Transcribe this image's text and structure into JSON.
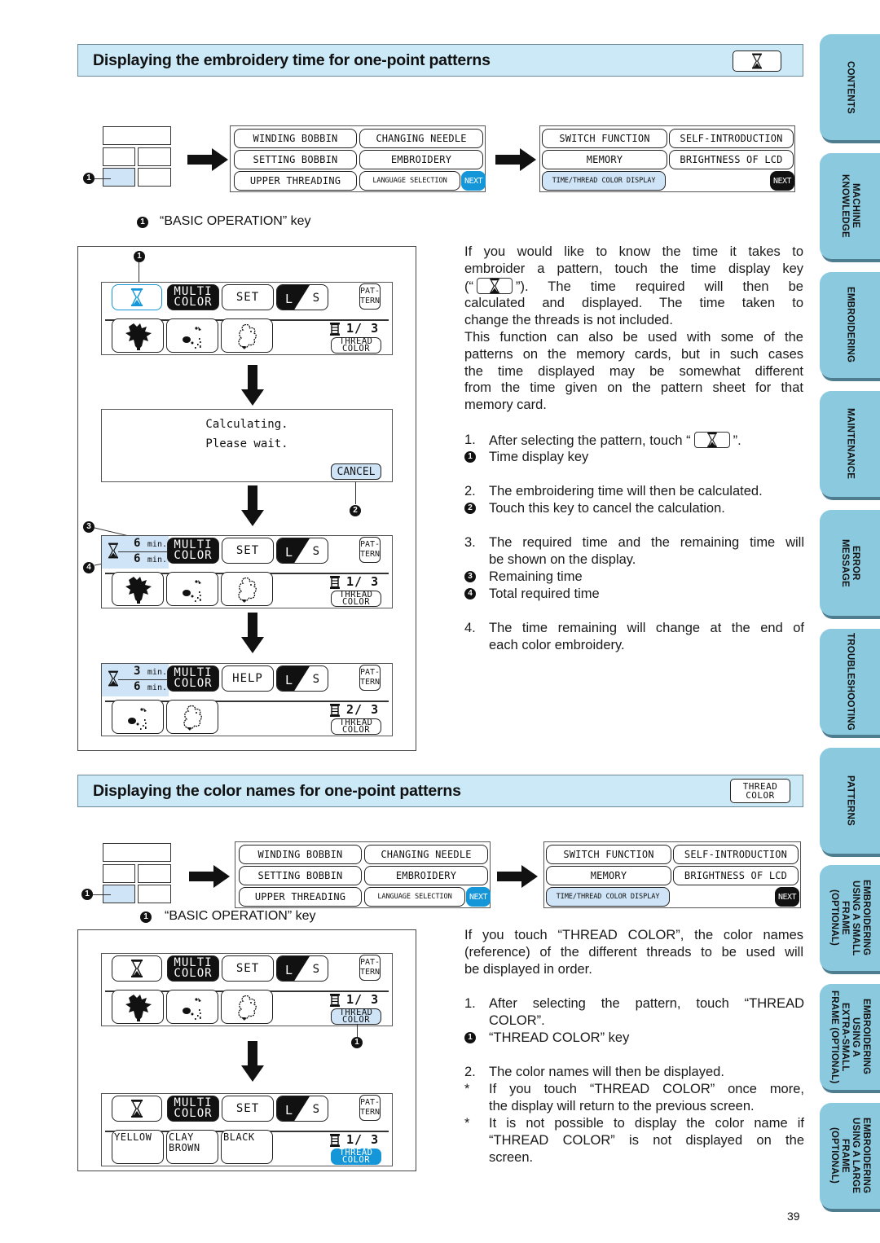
{
  "page": {
    "number": "39"
  },
  "colors": {
    "header_bg": "#cce9f8",
    "tab_bg": "#8bc9de",
    "selected_key": "#cfe4f6",
    "active_blue": "#1496d8"
  },
  "section1": {
    "title": "Displaying the embroidery time for one-point patterns",
    "header_key_icon": "hourglass-icon",
    "basic_op_caption": "“BASIC OPERATION” key",
    "callout_1": "1",
    "menu1": {
      "buttons": [
        "WINDING BOBBIN",
        "CHANGING NEEDLE",
        "SETTING BOBBIN",
        "EMBROIDERY",
        "UPPER THREADING",
        "LANGUAGE SELECTION"
      ],
      "next": "NEXT"
    },
    "menu2": {
      "buttons": [
        "SWITCH FUNCTION",
        "SELF-INTRODUCTION",
        "MEMORY",
        "BRIGHTNESS OF LCD",
        "TIME/THREAD COLOR DISPLAY"
      ],
      "next": "NEXT"
    },
    "screens": {
      "multi_color": [
        "MULTI",
        "COLOR"
      ],
      "set": "SET",
      "help": "HELP",
      "size_l": "L",
      "size_s": "S",
      "pattern_key": [
        "PAT-",
        "TERN"
      ],
      "thread_color": [
        "THREAD",
        "COLOR"
      ],
      "counter_1": "1/ 3",
      "counter_2": "2/ 3",
      "dialog_lines": [
        "Calculating.",
        "Please wait."
      ],
      "cancel": "CANCEL",
      "time_a": {
        "remaining": "6",
        "total": "6",
        "unit": "min."
      },
      "time_b": {
        "remaining": "3",
        "total": "6",
        "unit": "min."
      },
      "callouts": [
        "1",
        "2",
        "3",
        "4"
      ]
    },
    "intro_lines": [
      "If you would like to know the time it takes to",
      "embroider a pattern, touch the time display key",
      "(“|”). The time required will then be",
      "calculated and displayed. The time taken to",
      "change the threads is not included.",
      "This function can also be used with some of the",
      "patterns on the memory cards, but in such cases",
      "the time displayed may be somewhat different",
      "from the time given on the pattern sheet for that",
      "memory card."
    ],
    "intro_open": "(“",
    "intro_close": "”). The time required will then be",
    "steps": [
      {
        "n": "1.",
        "lines": [
          "After selecting the pattern, touch “"
        ],
        "suffix": "”."
      },
      {
        "n": "2.",
        "lines": [
          "The embroidering time will then be calculated."
        ]
      },
      {
        "n": "3.",
        "lines": [
          "The required time and the remaining time will",
          "be shown on the display."
        ]
      },
      {
        "n": "4.",
        "lines": [
          "The time remaining will change at the end of",
          "each color embroidery."
        ]
      }
    ],
    "notes": {
      "n1": "Time display key",
      "n2": "Touch this key to cancel the calculation.",
      "n3": "Remaining time",
      "n4": "Total required time"
    }
  },
  "section2": {
    "title": "Displaying the color names for one-point patterns",
    "header_key": [
      "THREAD",
      "COLOR"
    ],
    "basic_op_caption": "“BASIC OPERATION” key",
    "callout_1": "1",
    "color_names": [
      "YELLOW",
      "CLAY BROWN",
      "BLACK"
    ],
    "color_name_lines": [
      [
        "YELLOW"
      ],
      [
        "CLAY",
        "BROWN"
      ],
      [
        "BLACK"
      ]
    ],
    "intro_lines": [
      "If you touch “THREAD COLOR”, the color names",
      "(reference) of the different threads to be used will",
      "be displayed in order."
    ],
    "step1": {
      "n": "1.",
      "lines": [
        "After selecting the pattern, touch “THREAD",
        "COLOR”."
      ]
    },
    "note1": "“THREAD COLOR” key",
    "step2": {
      "n": "2.",
      "text": "The color names will then be displayed."
    },
    "asterisks": [
      {
        "mark": "*",
        "lines": [
          "If you touch “THREAD COLOR” once more,",
          "the display will return to the previous screen."
        ]
      },
      {
        "mark": "*",
        "lines": [
          "It is not possible to display the color name if",
          "“THREAD COLOR” is not displayed on the",
          "screen."
        ]
      }
    ]
  },
  "side_tabs": [
    "CONTENTS",
    "MACHINE\nKNOWLEDGE",
    "EMBROIDERING",
    "MAINTENANCE",
    "ERROR\nMESSAGE",
    "TROUBLESHOOTING",
    "PATTERNS",
    "EMBROIDERING\nUSING A SMALL\nFRAME\n(OPTIONAL)",
    "EMBROIDERING\nUSING A\nEXTRA-SMALL\nFRAME (OPTIONAL)",
    "EMBROIDERING\nUSING A LARGE\nFRAME\n(OPTIONAL)"
  ]
}
